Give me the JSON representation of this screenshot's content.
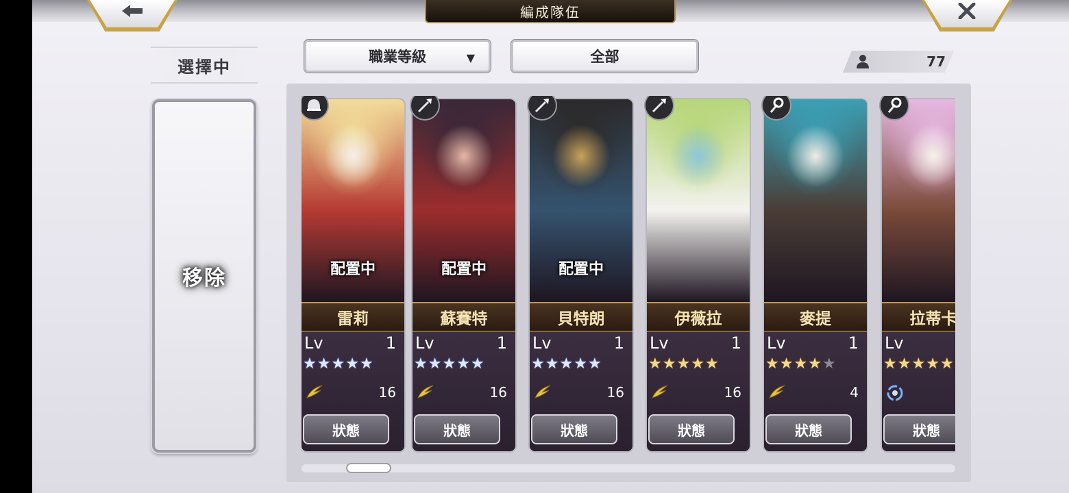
{
  "header": {
    "title": "編成隊伍",
    "back_icon": "back-arrow-icon",
    "close_icon": "close-x-icon"
  },
  "left": {
    "selected_label": "選擇中",
    "remove_label": "移除"
  },
  "filters": {
    "sort_label": "職業等級",
    "sort_icon": "dropdown-triangle-icon",
    "category_label": "全部"
  },
  "unit_count": {
    "icon": "person-icon",
    "value": "77"
  },
  "cards": [
    {
      "name": "雷莉",
      "placed": "配置中",
      "lv_label": "Lv",
      "level": "1",
      "stars": 5,
      "star_color": "blue",
      "element_icon": "wind-icon",
      "element_value": "16",
      "status": "狀態",
      "class_icon": "helmet-icon",
      "art": [
        "#f2dc9a",
        "#b53a33",
        "#f6f0ea"
      ]
    },
    {
      "name": "蘇賽特",
      "placed": "配置中",
      "lv_label": "Lv",
      "level": "1",
      "stars": 5,
      "star_color": "blue",
      "element_icon": "wind-icon",
      "element_value": "16",
      "status": "狀態",
      "class_icon": "spear-icon",
      "art": [
        "#3a2838",
        "#9c2d2d",
        "#e8b7a8"
      ]
    },
    {
      "name": "貝特朗",
      "placed": "配置中",
      "lv_label": "Lv",
      "level": "1",
      "stars": 5,
      "star_color": "blue",
      "element_icon": "wind-icon",
      "element_value": "16",
      "status": "狀態",
      "class_icon": "spear-icon",
      "art": [
        "#2c2a2b",
        "#35536e",
        "#c8a25a"
      ]
    },
    {
      "name": "伊薇拉",
      "placed": "",
      "lv_label": "Lv",
      "level": "1",
      "stars": 5,
      "star_color": "gold",
      "element_icon": "wind-icon",
      "element_value": "16",
      "status": "狀態",
      "class_icon": "spear-icon",
      "art": [
        "#b7d67a",
        "#f4f2ef",
        "#8fc7d9"
      ]
    },
    {
      "name": "麥提",
      "placed": "",
      "lv_label": "Lv",
      "level": "1",
      "stars": 4,
      "star_color": "gold",
      "element_icon": "wind-icon",
      "element_value": "4",
      "status": "狀態",
      "class_icon": "staff-icon",
      "art": [
        "#3b9fb4",
        "#4a3d36",
        "#f0ece6"
      ]
    },
    {
      "name": "拉蒂卡",
      "placed": "",
      "lv_label": "Lv",
      "level": "",
      "stars": 5,
      "star_color": "gold",
      "element_icon": "water-swirl-icon",
      "element_value": "",
      "status": "狀態",
      "class_icon": "staff-icon",
      "art": [
        "#e6b7e0",
        "#7a4a3a",
        "#f6f2ea"
      ]
    }
  ],
  "scrollbar": {
    "position": 0.07
  }
}
